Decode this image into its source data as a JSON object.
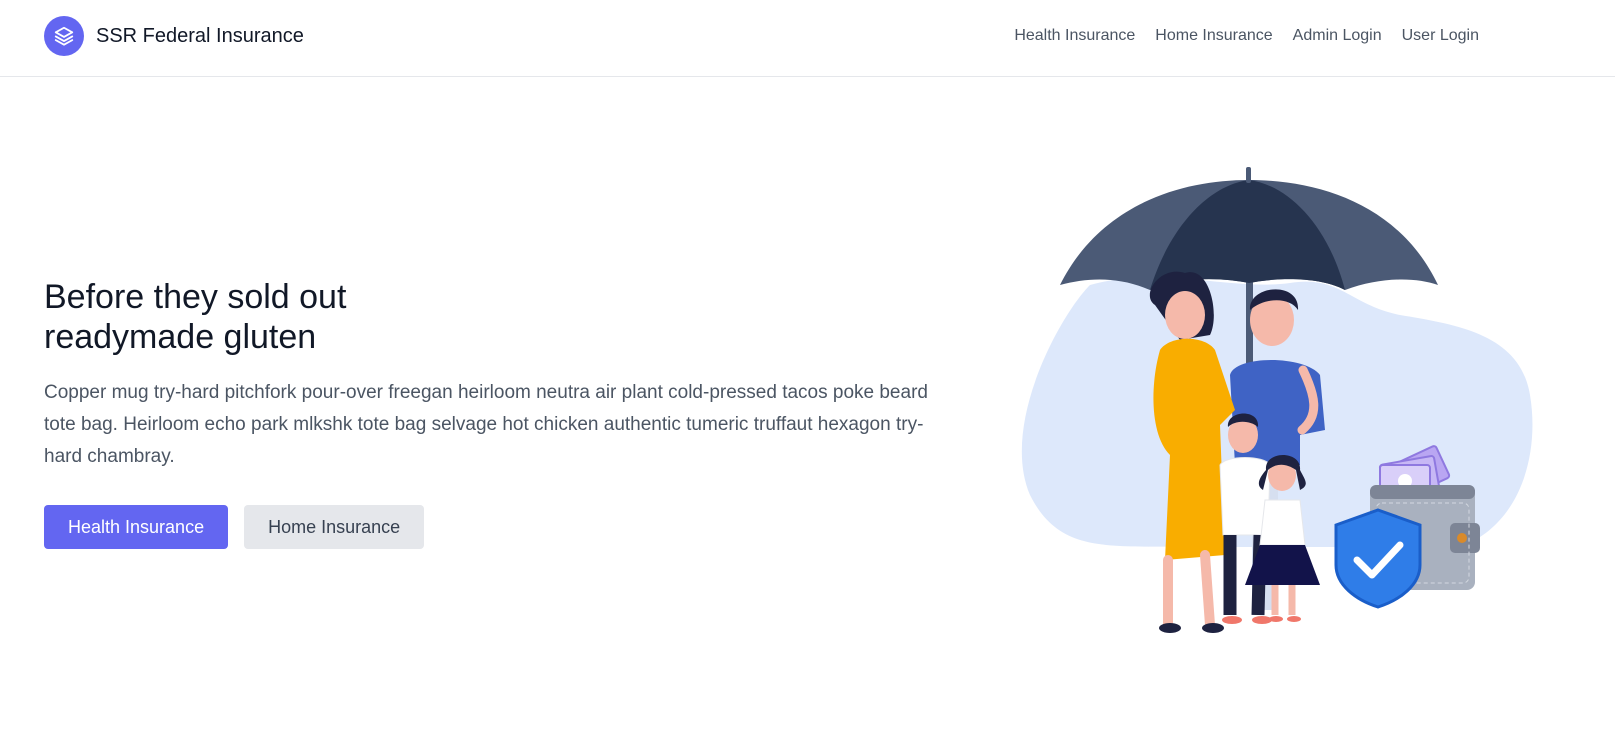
{
  "header": {
    "brand_name": "SSR Federal Insurance",
    "logo_icon": "layers-icon",
    "nav": [
      {
        "label": "Health Insurance"
      },
      {
        "label": "Home Insurance"
      },
      {
        "label": "Admin Login"
      },
      {
        "label": "User Login"
      }
    ]
  },
  "hero": {
    "title": "Before they sold out readymade gluten",
    "description": "Copper mug try-hard pitchfork pour-over freegan heirloom neutra air plant cold-pressed tacos poke beard tote bag. Heirloom echo park mlkshk tote bag selvage hot chicken authentic tumeric truffaut hexagon try-hard chambray.",
    "primary_button": "Health Insurance",
    "secondary_button": "Home Insurance",
    "illustration": "family-under-umbrella-illustration"
  },
  "colors": {
    "accent": "#6366f1",
    "secondary_button_bg": "#e5e7eb",
    "text_dark": "#111827",
    "text_muted": "#4b5563"
  }
}
